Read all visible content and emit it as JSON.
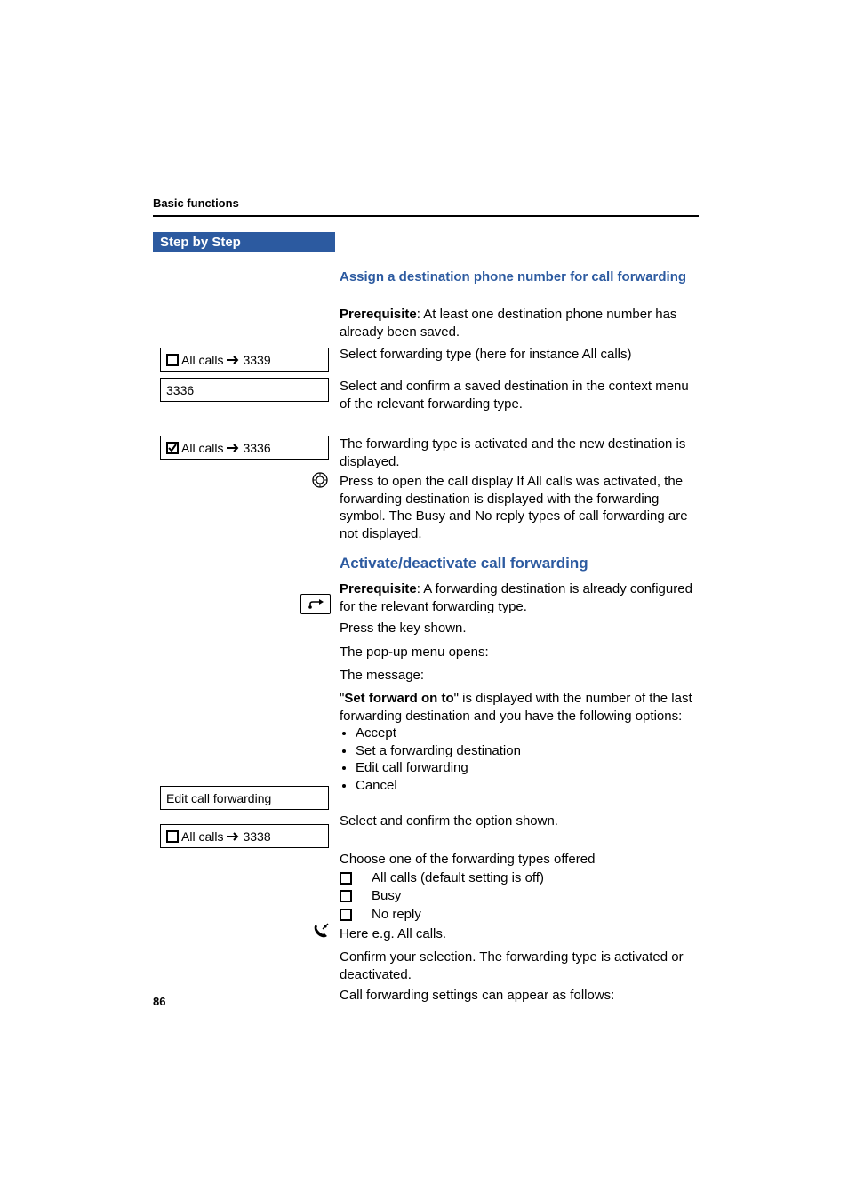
{
  "breadcrumb": "Basic functions",
  "sidebar_header": "Step by Step",
  "left": {
    "box1": {
      "prefix": "All calls",
      "dest": "3339",
      "checked": false
    },
    "box2": {
      "text": "3336"
    },
    "box3": {
      "prefix": "All calls",
      "dest": "3336",
      "checked": true
    },
    "box4": {
      "text": "Edit call forwarding"
    },
    "box5": {
      "prefix": "All calls",
      "dest": "3338",
      "checked": false
    }
  },
  "content": {
    "title1": "Assign a destination phone number for call forwarding",
    "prereq_label": "Prerequisite",
    "prereq1_rest": ": At least one destination phone number has already been saved.",
    "p_select_type": "Select forwarding type (here for instance All calls)",
    "p_select_dest": "Select and confirm a saved destination in the context menu of the relevant forwarding type.",
    "p_activated": "The forwarding type is activated and the new destination is displayed.",
    "p_press_open": "Press to open the call display If All calls was activated, the forwarding destination is displayed with the forwarding symbol. The Busy and No reply types of call forwarding are not displayed.",
    "title2": "Activate/deactivate call forwarding",
    "prereq2_rest": ": A forwarding destination is already configured for the relevant forwarding type.",
    "p_press_key": "Press the key shown.",
    "p_popup": "The pop-up menu opens:",
    "p_message": "The message:",
    "set_forward_label": "Set forward on to",
    "p_set_forward_rest": "\" is displayed with the number of the last forwarding destination and you have the following options:",
    "options": [
      "Accept",
      "Set a forwarding destination",
      "Edit call forwarding",
      "Cancel"
    ],
    "p_select_option": "Select and confirm the option shown.",
    "p_choose_type": "Choose one of the forwarding types offered",
    "checks": [
      "All calls (default setting is off)",
      "Busy",
      "No reply"
    ],
    "p_here": "Here e.g. All calls.",
    "p_confirm": "Confirm your selection. The forwarding type is activated or deactivated.",
    "p_settings_follow": "Call forwarding settings can appear as follows:"
  },
  "page_number": "86"
}
